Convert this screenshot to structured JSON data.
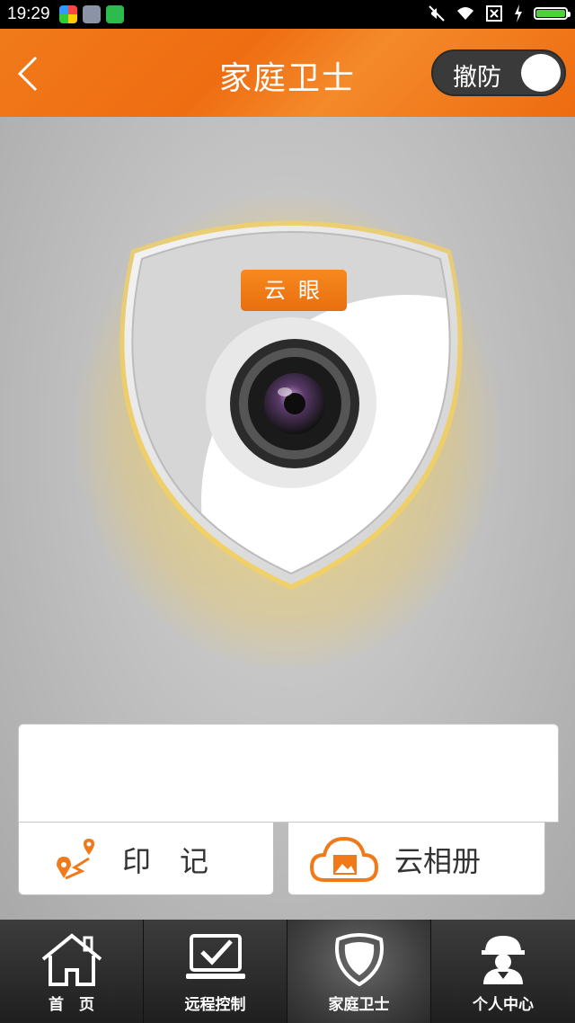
{
  "status_bar": {
    "time": "19:29",
    "icons": [
      "app-icon-colorful",
      "app-icon-gray",
      "app-icon-green",
      "mute-icon",
      "wifi-icon",
      "sim-icon",
      "charging-icon",
      "battery-icon"
    ]
  },
  "header": {
    "title": "家庭卫士",
    "toggle_label": "撤防",
    "background_color": "#f07a1a"
  },
  "hero": {
    "tag_label": "云眼",
    "icons": [
      "shield-icon",
      "camera-lens-icon"
    ]
  },
  "actions": {
    "yin_label": "印　记",
    "album_label": "云相册",
    "yin_icon": "map-route-icon",
    "album_icon": "cloud-photo-icon"
  },
  "nav": {
    "items": [
      {
        "label": "首　页",
        "icon": "home-icon",
        "active": false
      },
      {
        "label": "远程控制",
        "icon": "laptop-check-icon",
        "active": false
      },
      {
        "label": "家庭卫士",
        "icon": "shield-icon",
        "active": true
      },
      {
        "label": "个人中心",
        "icon": "person-icon",
        "active": false
      }
    ]
  },
  "colors": {
    "accent": "#f07a1a",
    "glow": "#ffc81e",
    "nav_bg": "#2d2d2d"
  }
}
